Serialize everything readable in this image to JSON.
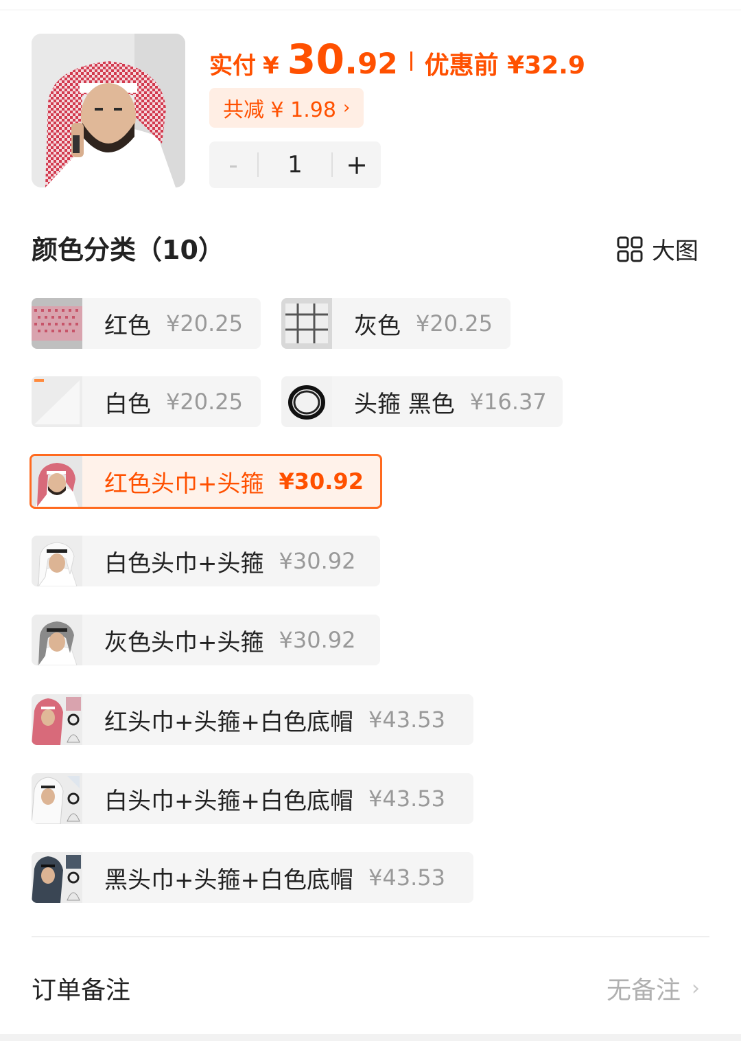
{
  "header": {
    "paid_label": "实付",
    "currency": "¥",
    "paid_int": "30",
    "paid_dot": ".",
    "paid_dec": "92",
    "original_price": "优惠前 ¥32.9",
    "discount": "共减 ¥ 1.98",
    "discount_chevron": "›",
    "quantity": "1",
    "minus": "-",
    "plus": "+"
  },
  "section": {
    "title": "颜色分类（10）",
    "big_view_label": "大图",
    "big_view_icon": "grid-icon"
  },
  "options": [
    {
      "name": "红色",
      "price": "¥20.25",
      "selected": false,
      "thumb": "red-scarf"
    },
    {
      "name": "灰色",
      "price": "¥20.25",
      "selected": false,
      "thumb": "grey-scarf"
    },
    {
      "name": "白色",
      "price": "¥20.25",
      "selected": false,
      "thumb": "white-scarf"
    },
    {
      "name": "头箍 黑色",
      "price": "¥16.37",
      "selected": false,
      "thumb": "black-ring"
    },
    {
      "name": "红色头巾+头箍",
      "price": "¥30.92",
      "selected": true,
      "thumb": "model-red"
    },
    {
      "name": "白色头巾+头箍",
      "price": "¥30.92",
      "selected": false,
      "thumb": "model-white"
    },
    {
      "name": "灰色头巾+头箍",
      "price": "¥30.92",
      "selected": false,
      "thumb": "model-grey"
    },
    {
      "name": "红头巾+头箍+白色底帽",
      "price": "¥43.53",
      "selected": false,
      "thumb": "combo-red"
    },
    {
      "name": "白头巾+头箍+白色底帽",
      "price": "¥43.53",
      "selected": false,
      "thumb": "combo-white"
    },
    {
      "name": "黑头巾+头箍+白色底帽",
      "price": "¥43.53",
      "selected": false,
      "thumb": "combo-black"
    }
  ],
  "footer": {
    "note_label": "订单备注",
    "note_value": "无备注",
    "chevron": "›"
  },
  "colors": {
    "accent": "#ff5000",
    "selected_border": "#ff6a1f",
    "chip_bg": "#ffeee4",
    "option_bg": "#f5f5f5"
  }
}
